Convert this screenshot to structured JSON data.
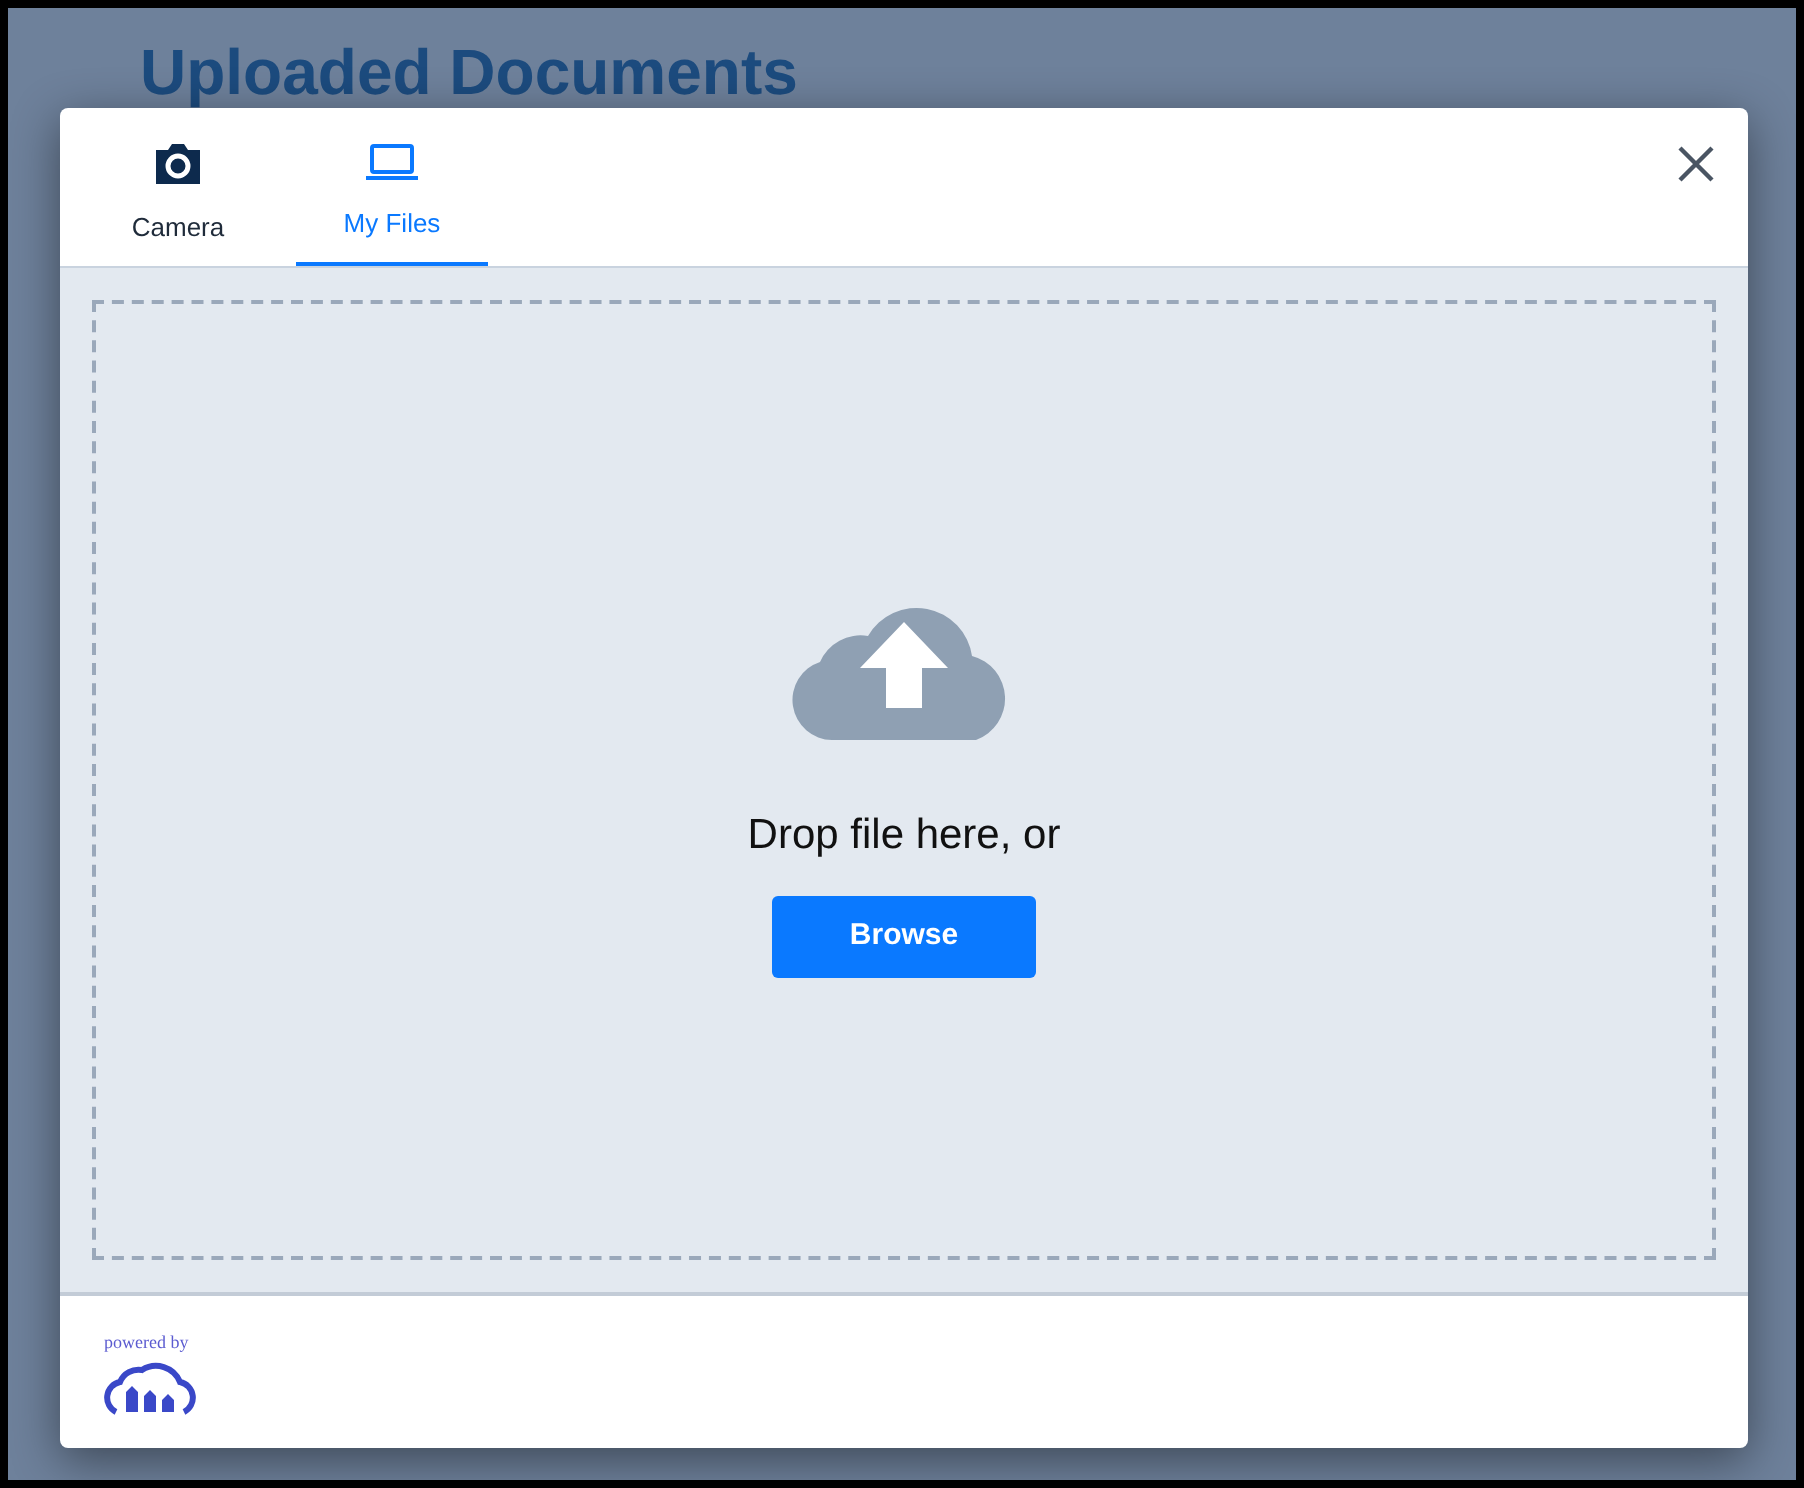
{
  "page": {
    "title": "Uploaded Documents"
  },
  "tabs": [
    {
      "label": "Camera",
      "selected": false
    },
    {
      "label": "My Files",
      "selected": true
    }
  ],
  "dropzone": {
    "prompt": "Drop file here, or",
    "button": "Browse"
  },
  "footer": {
    "powered_by": "powered by"
  }
}
